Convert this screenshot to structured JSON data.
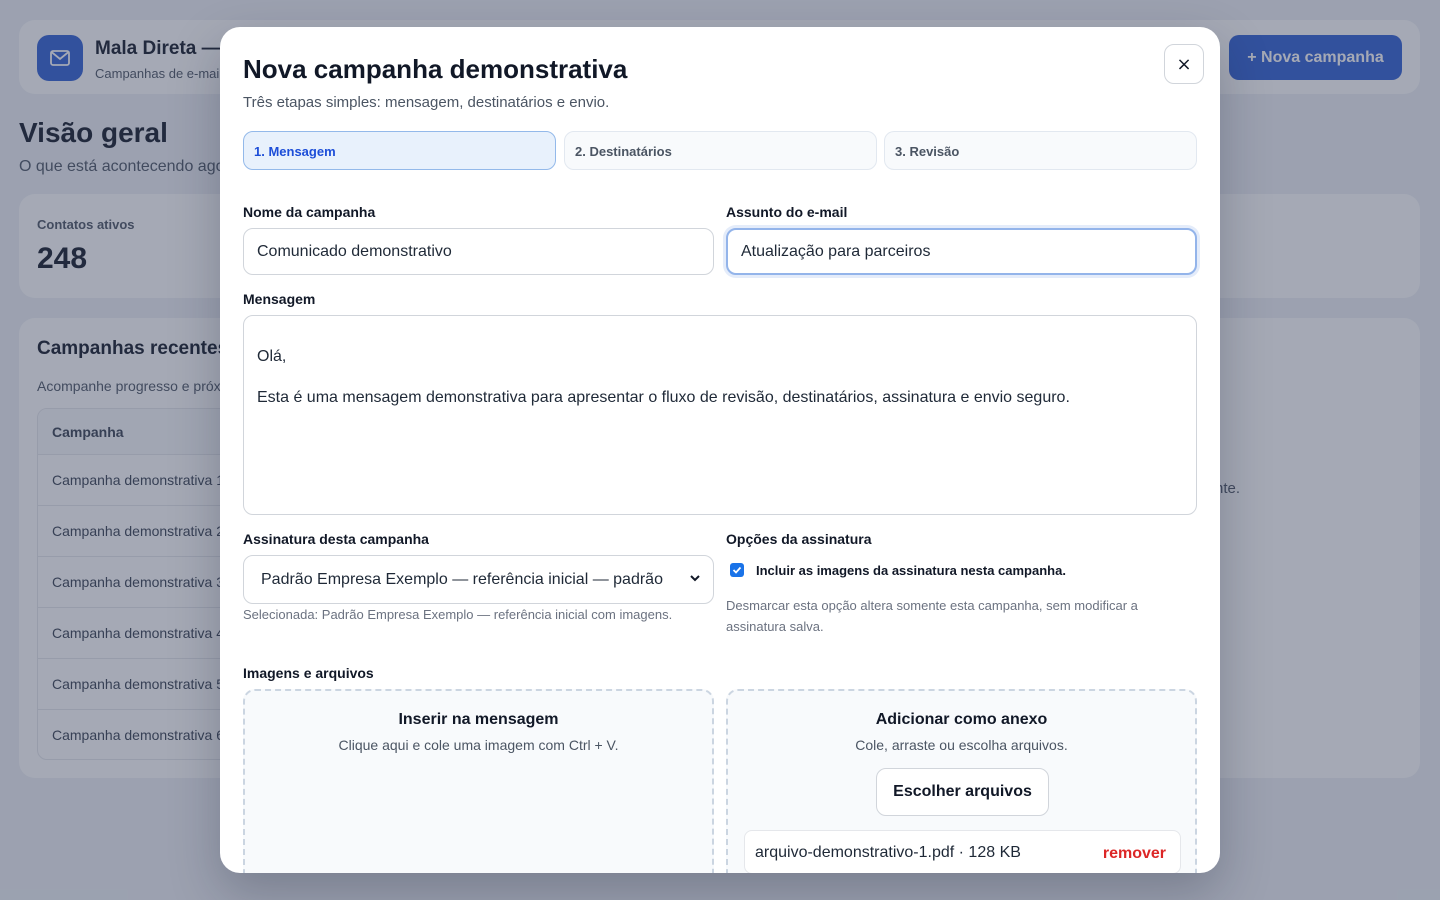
{
  "app": {
    "title": "Mala Direta —",
    "subtitle": "Campanhas de e-mai",
    "new_campaign_label": "+ Nova campanha"
  },
  "overview": {
    "title": "Visão geral",
    "subtitle": "O que está acontecendo ago"
  },
  "stats": {
    "active_contacts_label": "Contatos ativos",
    "active_contacts_value": "248"
  },
  "recent": {
    "title": "Campanhas recentes",
    "subtitle": "Acompanhe progresso e próx",
    "column_header": "Campanha",
    "rows": [
      "Campanha demonstrativa 1",
      "Campanha demonstrativa 2",
      "Campanha demonstrativa 3",
      "Campanha demonstrativa 4",
      "Campanha demonstrativa 5",
      "Campanha demonstrativa 6"
    ],
    "side_hint": "nte."
  },
  "modal": {
    "title": "Nova campanha demonstrativa",
    "subtitle": "Três etapas simples: mensagem, destinatários e envio.",
    "close_label": "×",
    "steps": [
      {
        "label": "1. Mensagem",
        "active": true
      },
      {
        "label": "2. Destinatários",
        "active": false
      },
      {
        "label": "3. Revisão",
        "active": false
      }
    ],
    "campaign_name": {
      "label": "Nome da campanha",
      "value": "Comunicado demonstrativo"
    },
    "subject": {
      "label": "Assunto do e-mail",
      "value": "Atualização para parceiros"
    },
    "message": {
      "label": "Mensagem",
      "greeting": "Olá,",
      "body": "Esta é uma mensagem demonstrativa para apresentar o fluxo de revisão, destinatários, assinatura e envio seguro."
    },
    "signature": {
      "label": "Assinatura desta campanha",
      "selected": "Padrão Empresa Exemplo — referência inicial — padrão",
      "hint": "Selecionada: Padrão Empresa Exemplo — referência inicial com imagens."
    },
    "signature_options": {
      "label": "Opções da assinatura",
      "checkbox_label": "Incluir as imagens da assinatura nesta campanha.",
      "checked": true,
      "hint": "Desmarcar esta opção altera somente esta campanha, sem modificar a assinatura salva."
    },
    "files": {
      "label": "Imagens e arquivos",
      "inline": {
        "title": "Inserir na mensagem",
        "subtitle": "Clique aqui e cole uma imagem com Ctrl + V."
      },
      "attachment": {
        "title": "Adicionar como anexo",
        "subtitle": "Cole, arraste ou escolha arquivos.",
        "button_label": "Escolher arquivos",
        "file_entry": "arquivo-demonstrativo-1.pdf · 128 KB",
        "remove_label": "remover"
      }
    }
  },
  "colors": {
    "accent": "#2f5fd3",
    "step_active_bg": "#e8f1fc",
    "step_active_text": "#1d4ed8",
    "danger": "#dc2626",
    "checkbox": "#1a73e8"
  }
}
